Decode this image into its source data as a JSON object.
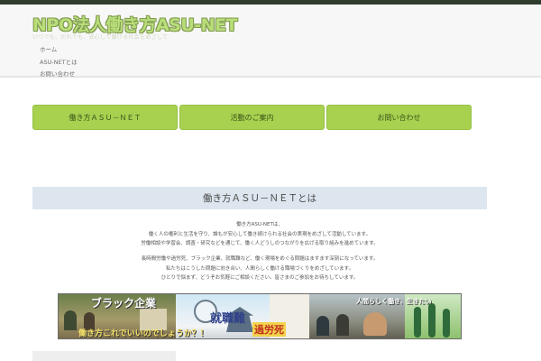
{
  "header": {
    "site_title": "NPO法人働き方ASU-NET",
    "tagline": "いつでも、だれでも、安心して働ける社会をめざして",
    "nav": [
      "ホーム",
      "ASU-NETとは",
      "お問い合わせ"
    ]
  },
  "buttons": [
    "働き方ＡＳＵ－ＮＥＴ",
    "活動のご案内",
    "お問い合わせ"
  ],
  "intro": {
    "title": "働き方ＡＳＵ－ＮＥＴとは",
    "para1": [
      "働き方ASU-NETは、",
      "働く人の権利と生活を守り、誰もが安心して働き続けられる社会の実現をめざして活動しています。",
      "労働相談や学習会、調査・研究などを通じて、働く人どうしのつながりを広げる取り組みを進めています。"
    ],
    "para2": [
      "長時間労働や過労死、ブラック企業、就職難など、働く現場をめぐる問題はますます深刻になっています。",
      "私たちはこうした問題に向き合い、人間らしく働ける職場づくりをめざしています。",
      "ひとりで悩まず、どうぞお気軽にご相談ください。皆さまのご参加をお待ちしています。"
    ]
  },
  "banner": {
    "text_black_company": "ブラック企業",
    "text_question": "働き方これでいいのでしょうか？！",
    "text_job_hunting": "就職難",
    "text_karoshi": "過労死",
    "text_humane": "人間らしく働き、生きたい",
    "colors": {
      "frame": "#3d5a25",
      "lime": "#a8d24b",
      "sky": "#9fd6ef",
      "gold": "#f0d060"
    }
  }
}
